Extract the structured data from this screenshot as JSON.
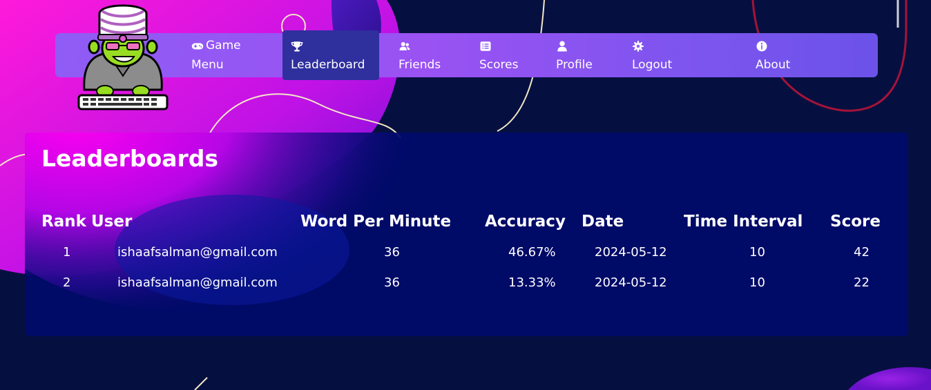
{
  "nav": {
    "items": [
      {
        "key": "game",
        "line1": "Game",
        "line2": "Menu",
        "icon": "gamepad-icon"
      },
      {
        "key": "leaderboard",
        "label": "Leaderboard",
        "icon": "trophy-icon",
        "active": true
      },
      {
        "key": "friends",
        "label": "Friends",
        "icon": "users-icon"
      },
      {
        "key": "scores",
        "label": "Scores",
        "icon": "list-icon"
      },
      {
        "key": "profile",
        "label": "Profile",
        "icon": "user-icon"
      },
      {
        "key": "logout",
        "label": "Logout",
        "icon": "gear-icon"
      },
      {
        "key": "about",
        "label": "About",
        "icon": "info-icon"
      }
    ]
  },
  "leaderboard": {
    "title": "Leaderboards",
    "columns": {
      "rank": "Rank",
      "user": "User",
      "wpm": "Word Per Minute",
      "accuracy": "Accuracy",
      "date": "Date",
      "interval": "Time Interval",
      "score": "Score"
    },
    "rows": [
      {
        "rank": "1",
        "user": "ishaafsalman@gmail.com",
        "wpm": "36",
        "accuracy": "46.67%",
        "date": "2024-05-12",
        "interval": "10",
        "score": "42"
      },
      {
        "rank": "2",
        "user": "ishaafsalman@gmail.com",
        "wpm": "36",
        "accuracy": "13.33%",
        "date": "2024-05-12",
        "interval": "10",
        "score": "22"
      }
    ]
  },
  "colors": {
    "background": "#061040",
    "navbar": "#8f5cf5",
    "nav_active": "#2f2f9e",
    "panel": "#000a6a",
    "accent_magenta": "#ff00dd"
  }
}
